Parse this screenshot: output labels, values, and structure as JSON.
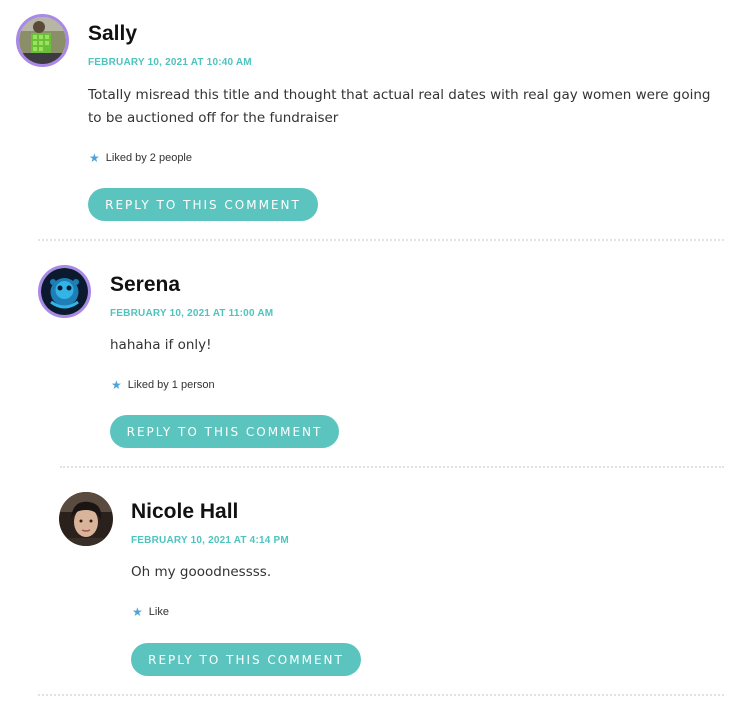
{
  "accent_color": "#5bc4be",
  "avatar_ring_color": "#a889e6",
  "comments": [
    {
      "author": "Sally",
      "date": "FEBRUARY 10, 2021 AT 10:40 AM",
      "text": "Totally misread this title and thought that actual real dates with real gay women were going to be auctioned off for the fundraiser",
      "likes": "Liked by 2 people",
      "reply_label": "REPLY TO THIS COMMENT",
      "avatar_icon": "user-photo"
    },
    {
      "author": "Serena",
      "date": "FEBRUARY 10, 2021 AT 11:00 AM",
      "text": "hahaha if only!",
      "likes": "Liked by 1 person",
      "reply_label": "REPLY TO THIS COMMENT",
      "avatar_icon": "user-photo"
    },
    {
      "author": "Nicole Hall",
      "date": "FEBRUARY 10, 2021 AT 4:14 PM",
      "text": "Oh my gooodnessss.",
      "likes": "Like",
      "reply_label": "REPLY TO THIS COMMENT",
      "avatar_icon": "user-photo"
    }
  ]
}
